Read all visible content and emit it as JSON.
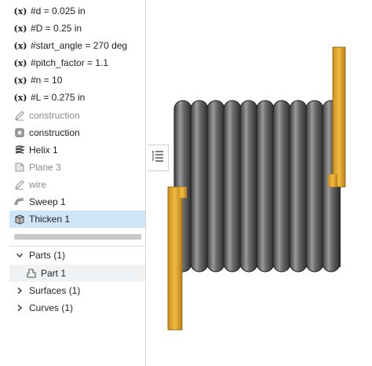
{
  "feature_tree": {
    "variables": [
      {
        "label": "#d = 0.025 in",
        "icon": "variable-icon",
        "icon_text": "(x)"
      },
      {
        "label": "#D = 0.25 in",
        "icon": "variable-icon",
        "icon_text": "(x)"
      },
      {
        "label": "#start_angle = 270 deg",
        "icon": "variable-icon",
        "icon_text": "(x)"
      },
      {
        "label": "#pitch_factor = 1.1",
        "icon": "variable-icon",
        "icon_text": "(x)"
      },
      {
        "label": "#n = 10",
        "icon": "variable-icon",
        "icon_text": "(x)"
      },
      {
        "label": "#L = 0.275 in",
        "icon": "variable-icon",
        "icon_text": "(x)"
      }
    ],
    "features": [
      {
        "label": "construction",
        "icon": "sketch-icon",
        "state": "suppressed"
      },
      {
        "label": "construction",
        "icon": "cylinder-icon",
        "state": "normal"
      },
      {
        "label": "Helix 1",
        "icon": "helix-icon",
        "state": "normal"
      },
      {
        "label": "Plane 3",
        "icon": "plane-icon",
        "state": "suppressed"
      },
      {
        "label": "wire",
        "icon": "sketch-icon",
        "state": "suppressed"
      },
      {
        "label": "Sweep 1",
        "icon": "sweep-icon",
        "state": "normal"
      },
      {
        "label": "Thicken 1",
        "icon": "thicken-icon",
        "state": "selected"
      }
    ]
  },
  "parts_list": {
    "parts_label": "Parts (1)",
    "part_item": "Part 1",
    "surfaces_label": "Surfaces (1)",
    "curves_label": "Curves (1)"
  },
  "colors": {
    "selected_row": "#cfe5f8",
    "wire_lead": "#e0a82e",
    "coil": "#5b5b5b"
  }
}
